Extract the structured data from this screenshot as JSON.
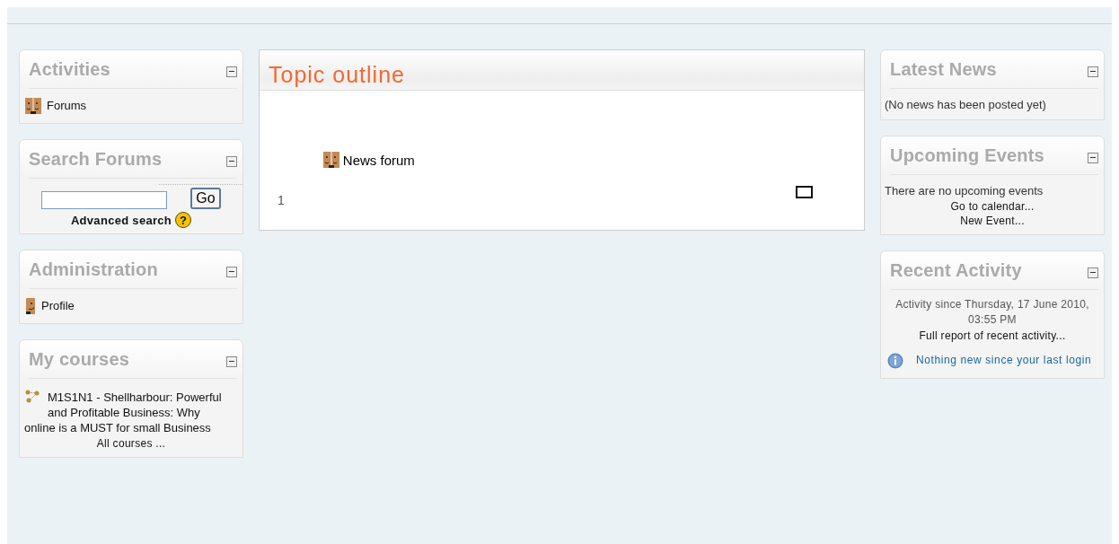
{
  "left_blocks": [
    {
      "title": "Activities",
      "items": [
        {
          "kind": "forum_link",
          "text": "Forums"
        }
      ]
    },
    {
      "title": "Search Forums",
      "items": [
        {
          "kind": "search",
          "button": "Go",
          "advanced": "Advanced search",
          "help": "?"
        }
      ]
    },
    {
      "title": "Administration",
      "items": [
        {
          "kind": "profile_link",
          "text": "Profile"
        }
      ]
    },
    {
      "title": "My courses",
      "items": [
        {
          "kind": "course_link",
          "text": "M1S1N1 - Shellharbour: Powerful and Profitable Business: Why online is a MUST for small Business"
        },
        {
          "kind": "center_link",
          "text": "All courses ..."
        }
      ]
    }
  ],
  "topic_outline": {
    "title": "Topic outline",
    "sections": [
      {
        "number": "1",
        "activities": [
          {
            "kind": "forum_link",
            "text": "News forum"
          }
        ]
      }
    ]
  },
  "right_blocks": [
    {
      "title": "Latest News",
      "items": [
        {
          "kind": "text",
          "text": "(No news has been posted yet)"
        }
      ]
    },
    {
      "title": "Upcoming Events",
      "items": [
        {
          "kind": "text",
          "text": "There are no upcoming events"
        },
        {
          "kind": "center_link",
          "text": "Go to calendar..."
        },
        {
          "kind": "center_link",
          "text": "New Event..."
        }
      ]
    },
    {
      "title": "Recent Activity",
      "items": [
        {
          "kind": "center_text",
          "text": "Activity since Thursday, 17 June 2010, 03:55 PM"
        },
        {
          "kind": "center_link",
          "text": "Full report of recent activity..."
        },
        {
          "kind": "info_link",
          "text": "Nothing new since your last login"
        }
      ]
    }
  ]
}
